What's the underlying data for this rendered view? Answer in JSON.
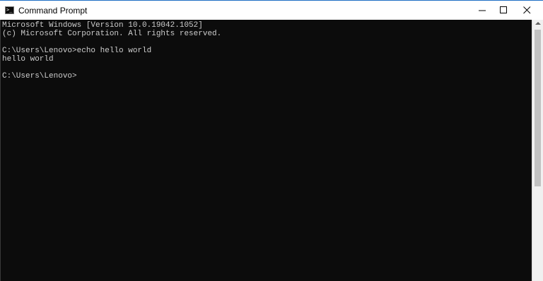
{
  "window": {
    "title": "Command Prompt",
    "icon": "cmd-icon",
    "icon_glyph": ">_"
  },
  "console": {
    "lines": [
      "Microsoft Windows [Version 10.0.19042.1052]",
      "(c) Microsoft Corporation. All rights reserved.",
      "C:\\Users\\Lenovo>echo hello world",
      "hello world",
      "C:\\Users\\Lenovo>"
    ]
  },
  "colors": {
    "background": "#0c0c0c",
    "text": "#cccccc",
    "titlebar": "#ffffff",
    "accent_border": "#1e6fc4"
  },
  "caption_buttons": {
    "minimize_icon": "minimize-icon",
    "maximize_icon": "maximize-icon",
    "close_icon": "close-icon"
  }
}
